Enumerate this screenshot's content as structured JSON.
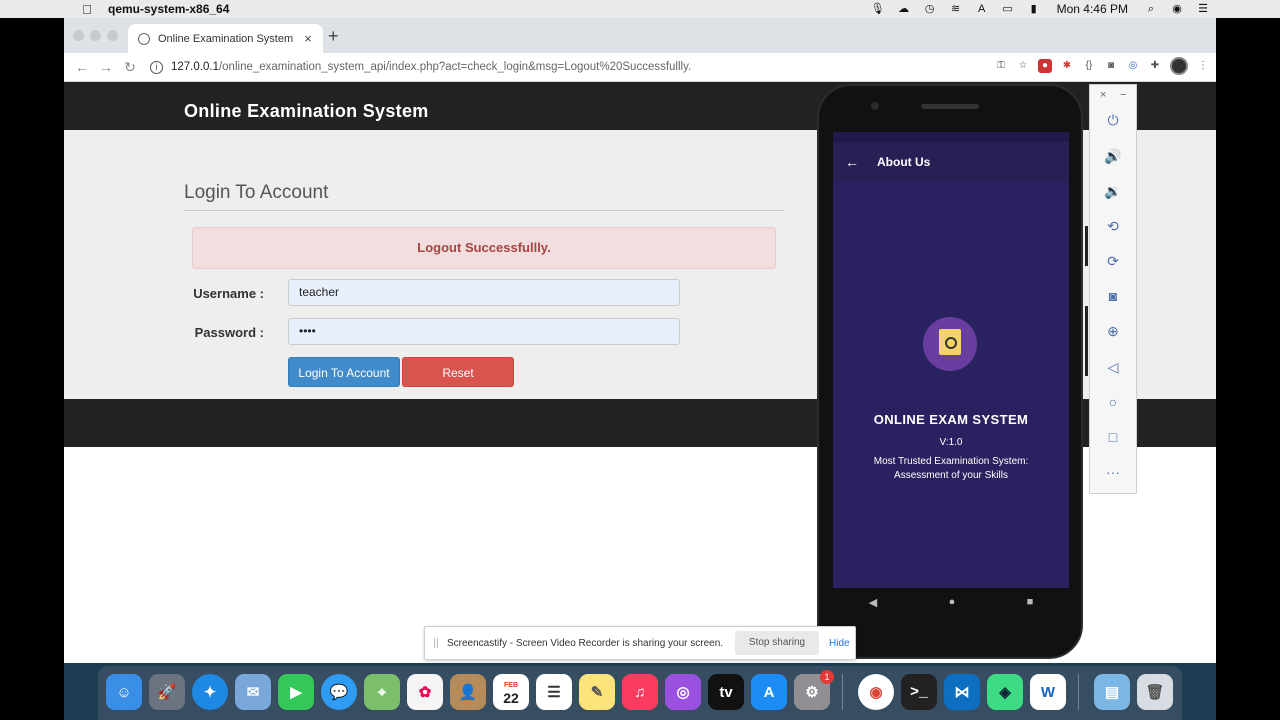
{
  "menubar": {
    "app_name": "qemu-system-x86_64",
    "clock": "Mon 4:46 PM"
  },
  "browser": {
    "tab_title": "Online Examination System",
    "url_host": "127.0.0.1",
    "url_path": "/online_examination_system_api/index.php?act=check_login&msg=Logout%20Successfullly."
  },
  "site": {
    "title": "Online Examination System",
    "login_heading": "Login To Account",
    "alert": "Logout Successfullly.",
    "username_label": "Username :",
    "username_value": "teacher",
    "password_label": "Password :",
    "password_value": "••••",
    "login_button": "Login To Account",
    "reset_button": "Reset"
  },
  "phone_app": {
    "appbar_title": "About Us",
    "name": "ONLINE EXAM SYSTEM",
    "version": "V:1.0",
    "description": "Most Trusted Examination System: Assessment of your Skills"
  },
  "share_bar": {
    "message": "Screencastify - Screen Video Recorder is sharing your screen.",
    "stop": "Stop sharing",
    "hide": "Hide"
  },
  "dock": {
    "calendar_month": "FEB",
    "calendar_day": "22",
    "settings_badge": "1"
  }
}
